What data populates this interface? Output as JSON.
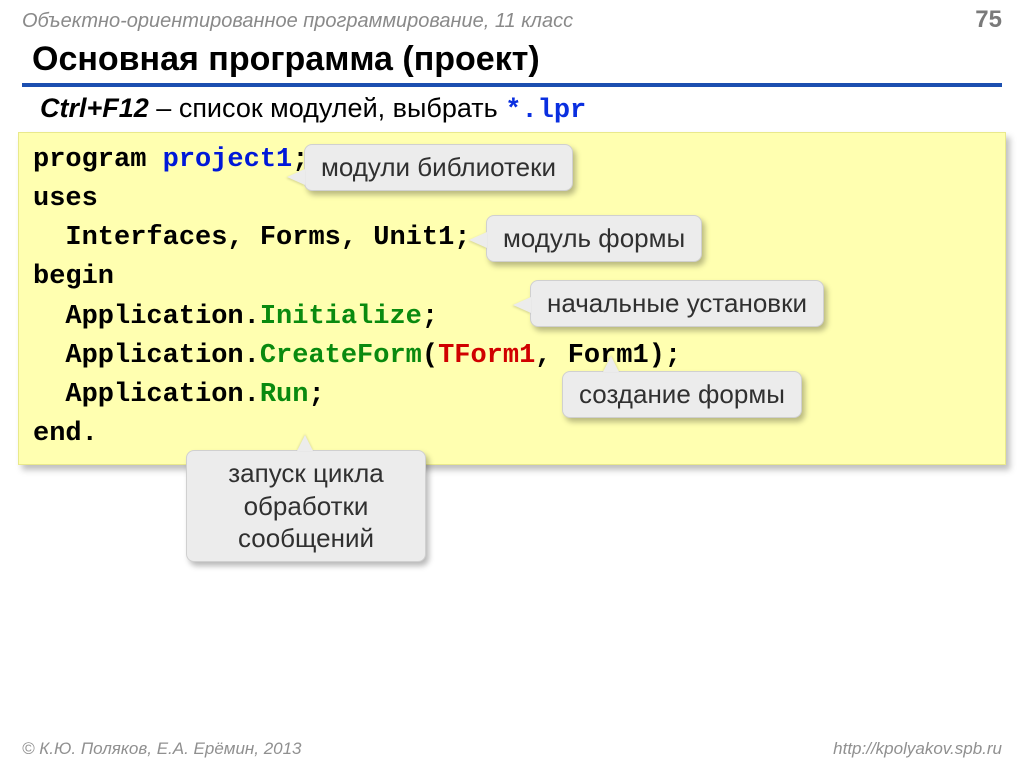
{
  "header": {
    "course": "Объектно-ориентированное программирование, 11 класс",
    "page": "75"
  },
  "title": "Основная программа (проект)",
  "subtitle": {
    "kbd": "Ctrl+F12",
    "text": " – список модулей, выбрать ",
    "ext": "*.lpr"
  },
  "code": {
    "l1a": "program ",
    "l1b": "project1",
    "l1c": ";",
    "l2": "uses",
    "l3": "  Interfaces, Forms, Unit1;",
    "l4": "begin",
    "l5a": "  Application.",
    "l5b": "Initialize",
    "l5c": ";",
    "l6a": "  Application.",
    "l6b": "CreateForm",
    "l6c": "(",
    "l6d": "TForm1",
    "l6e": ", Form1);",
    "l7a": "  Application.",
    "l7b": "Run",
    "l7c": ";",
    "l8": "end."
  },
  "callouts": {
    "c1": "модули библиотеки",
    "c2": "модуль формы",
    "c3": "начальные установки",
    "c4": "создание формы",
    "c5": "запуск цикла обработки сообщений"
  },
  "footer": {
    "copyright": "© К.Ю. Поляков, Е.А. Ерёмин, 2013",
    "url": "http://kpolyakov.spb.ru"
  }
}
